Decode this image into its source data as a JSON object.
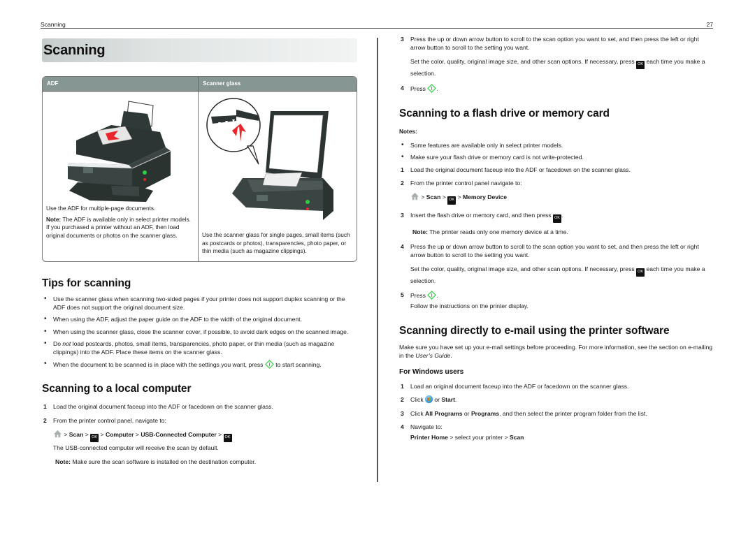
{
  "header": {
    "section": "Scanning",
    "page_number": "27"
  },
  "title": "Scanning",
  "table": {
    "headers": [
      "ADF",
      "Scanner glass"
    ],
    "adf": {
      "text": "Use the ADF for multiple-page documents.",
      "note_label": "Note:",
      "note": " The ADF is available only in select printer models. If you purchased a printer without an ADF, then load original documents or photos on the scanner glass."
    },
    "glass": {
      "text": "Use the scanner glass for single pages, small items (such as postcards or photos), transparencies, photo paper, or thin media (such as magazine clippings)."
    }
  },
  "tips": {
    "heading": "Tips for scanning",
    "items": [
      "Use the scanner glass when scanning two-sided pages if your printer does not support duplex scanning or the ADF does not support the original document size.",
      "When using the ADF, adjust the paper guide on the ADF to the width of the original document.",
      "When using the scanner glass, close the scanner cover, if possible, to avoid dark edges on the scanned image."
    ],
    "item4_pre": "Do ",
    "item4_em": "not",
    "item4_post": " load postcards, photos, small items, transparencies, photo paper, or thin media (such as magazine clippings) into the ADF. Place these items on the scanner glass.",
    "item5_pre": "When the document to be scanned is in place with the settings you want, press ",
    "item5_post": " to start scanning."
  },
  "local": {
    "heading": "Scanning to a local computer",
    "step1": "Load the original document faceup into the ADF or facedown on the scanner glass.",
    "step2": "From the printer control panel, navigate to:",
    "path": {
      "sep": " > ",
      "scan": "Scan",
      "computer": "Computer",
      "usb": "USB-Connected Computer"
    },
    "path_note": "The USB-connected computer will receive the scan by default.",
    "note_label": "Note:",
    "note": " Make sure the scan software is installed on the destination computer."
  },
  "cont": {
    "step3": "Press the up or down arrow button to scroll to the scan option you want to set, and then press the left or right arrow button to scroll to the setting you want.",
    "step3_sub_pre": "Set the color, quality, original image size, and other scan options. If necessary, press ",
    "step3_sub_post": " each time you make a selection.",
    "step4_pre": "Press ",
    "step4_post": "."
  },
  "flash": {
    "heading": "Scanning to a flash drive or memory card",
    "notes_label": "Notes:",
    "notes": [
      "Some features are available only in select printer models.",
      "Make sure your flash drive or memory card is not write-protected."
    ],
    "step1": "Load the original document faceup into the ADF or facedown on the scanner glass.",
    "step2": "From the printer control panel navigate to:",
    "path": {
      "sep": " > ",
      "scan": "Scan",
      "memory": "Memory Device"
    },
    "step3_pre": "Insert the flash drive or memory card, and then press ",
    "step3_post": ".",
    "note_label": "Note:",
    "note": " The printer reads only one memory device at a time.",
    "step4": "Press the up or down arrow button to scroll to the scan option you want to set, and then press the left or right arrow button to scroll to the setting you want.",
    "step4_sub_pre": "Set the color, quality, original image size, and other scan options. If necessary, press ",
    "step4_sub_post": " each time you make a selection.",
    "step5_pre": "Press ",
    "step5_post": ".",
    "step5_sub": "Follow the instructions on the printer display."
  },
  "email": {
    "heading": "Scanning directly to e-mail using the printer software",
    "intro_pre": "Make sure you have set up your e-mail settings before proceeding. For more information, see the section on e-mailing in the ",
    "intro_em": "User’s Guide",
    "intro_post": ".",
    "sub_heading": "For Windows users",
    "step1": "Load an original document faceup into the ADF or facedown on the scanner glass.",
    "step2_pre": "Click ",
    "step2_mid": " or ",
    "step2_bold": "Start",
    "step2_post": ".",
    "step3_pre": "Click ",
    "step3_b1": "All Programs",
    "step3_mid": " or ",
    "step3_b2": "Programs",
    "step3_post": ", and then select the printer program folder from the list.",
    "step4": "Navigate to:",
    "path_b1": "Printer Home",
    "path_mid": " > select your printer > ",
    "path_b2": "Scan"
  },
  "ok_label": "OK",
  "nums": [
    "1",
    "2",
    "3",
    "4",
    "5"
  ],
  "colors": {
    "table_header": "#869692",
    "start_green": "#2ecc40",
    "arrow_red": "#e8262b"
  }
}
